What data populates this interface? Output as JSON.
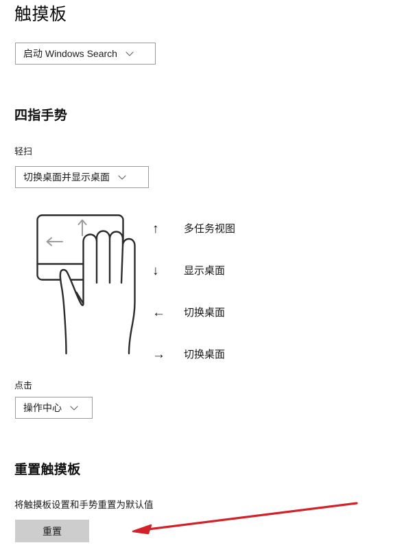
{
  "page": {
    "title": "触摸板"
  },
  "search_gesture": {
    "dropdown": {
      "value": "启动 Windows Search",
      "chevron_icon": "chevron-down-icon"
    }
  },
  "four_finger": {
    "heading": "四指手势",
    "swipe_label": "轻扫",
    "swipe_dropdown": {
      "value": "切换桌面并显示桌面",
      "chevron_icon": "chevron-down-icon"
    },
    "diagram": {
      "name": "four-finger-swipe-illustration",
      "up_arrow_icon": "arrow-up-icon",
      "left_arrow_icon": "arrow-left-icon",
      "right_arrow_icon": "arrow-right-icon"
    },
    "legend": [
      {
        "arrow": "↑",
        "icon": "arrow-up-icon",
        "label": "多任务视图"
      },
      {
        "arrow": "↓",
        "icon": "arrow-down-icon",
        "label": "显示桌面"
      },
      {
        "arrow": "←",
        "icon": "arrow-left-icon",
        "label": "切换桌面"
      },
      {
        "arrow": "→",
        "icon": "arrow-right-icon",
        "label": "切换桌面"
      }
    ],
    "tap_label": "点击",
    "tap_dropdown": {
      "value": "操作中心",
      "chevron_icon": "chevron-down-icon"
    }
  },
  "reset": {
    "heading": "重置触摸板",
    "description": "将触摸板设置和手势重置为默认值",
    "button_label": "重置"
  },
  "annotation": {
    "name": "red-pointer-arrow",
    "color": "#d42027"
  },
  "colors": {
    "background": "#ffffff",
    "text": "#111111",
    "combo_border": "#9a9a9a",
    "button_fill": "#cdcdcd",
    "diagram_stroke": "#2b2b2b",
    "diagram_arrow": "#9b9b9b",
    "annotation_red": "#d42027"
  }
}
